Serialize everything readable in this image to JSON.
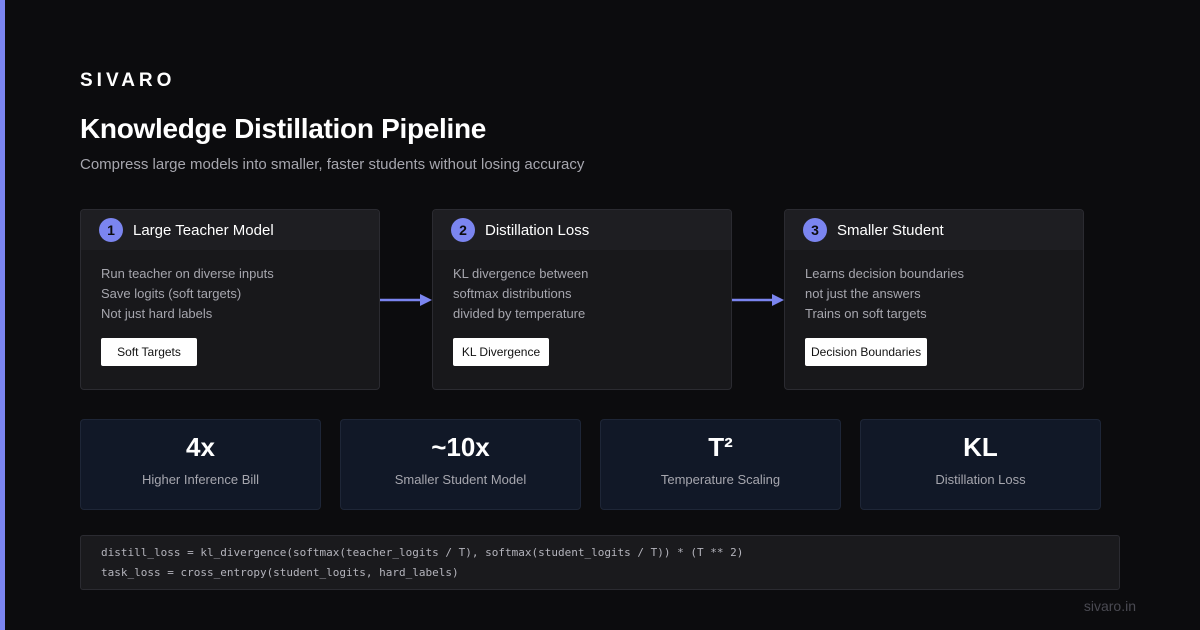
{
  "brand": "SIVARO",
  "title": "Knowledge Distillation Pipeline",
  "subtitle": "Compress large models into smaller, faster students without losing accuracy",
  "colors": {
    "accent": "#7b85f0",
    "background": "#0c0c0e",
    "card": "#18181b",
    "stat_card": "#111827"
  },
  "stages": [
    {
      "number": "1",
      "title": "Large Teacher Model",
      "lines": [
        "Run teacher on diverse inputs",
        "Save logits (soft targets)",
        "Not just hard labels"
      ],
      "chip": "Soft Targets"
    },
    {
      "number": "2",
      "title": "Distillation Loss",
      "lines": [
        "KL divergence between",
        "softmax distributions",
        "divided by temperature"
      ],
      "chip": "KL Divergence"
    },
    {
      "number": "3",
      "title": "Smaller Student",
      "lines": [
        "Learns decision boundaries",
        "not just the answers",
        "Trains on soft targets"
      ],
      "chip": "Decision Boundaries"
    }
  ],
  "stats": [
    {
      "value": "4x",
      "label": "Higher Inference Bill"
    },
    {
      "value": "~10x",
      "label": "Smaller Student Model"
    },
    {
      "value": "T²",
      "label": "Temperature Scaling"
    },
    {
      "value": "KL",
      "label": "Distillation Loss"
    }
  ],
  "code": [
    "distill_loss = kl_divergence(softmax(teacher_logits / T), softmax(student_logits / T)) * (T ** 2)",
    "task_loss = cross_entropy(student_logits, hard_labels)"
  ],
  "footer": "sivaro.in"
}
